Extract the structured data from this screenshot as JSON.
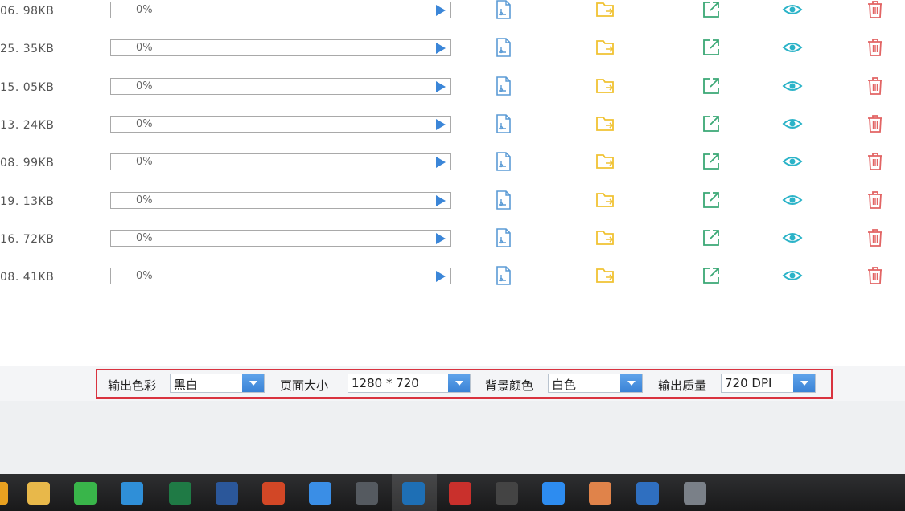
{
  "files": [
    {
      "size": "06. 98KB",
      "progress_text": "0%",
      "progress": 0
    },
    {
      "size": "25. 35KB",
      "progress_text": "0%",
      "progress": 0
    },
    {
      "size": "15. 05KB",
      "progress_text": "0%",
      "progress": 0
    },
    {
      "size": "13. 24KB",
      "progress_text": "0%",
      "progress": 0
    },
    {
      "size": "08. 99KB",
      "progress_text": "0%",
      "progress": 0
    },
    {
      "size": "19. 13KB",
      "progress_text": "0%",
      "progress": 0
    },
    {
      "size": "16. 72KB",
      "progress_text": "0%",
      "progress": 0
    },
    {
      "size": "08. 41KB",
      "progress_text": "0%",
      "progress": 0
    }
  ],
  "row_actions": [
    "file-icon",
    "folder-open-icon",
    "external-link-icon",
    "eye-icon",
    "trash-icon"
  ],
  "colors": {
    "file": "#5b9bd5",
    "folder": "#f0c233",
    "open": "#3aa875",
    "eye": "#2bb3c8",
    "trash": "#e26464",
    "play": "#3b86d8",
    "highlight": "#d9333f"
  },
  "options": {
    "color_label": "输出色彩",
    "color_value": "黑白",
    "page_size_label": "页面大小",
    "page_size_value": "1280 * 720",
    "background_label": "背景颜色",
    "background_value": "白色",
    "quality_label": "输出质量",
    "quality_value": "720 DPI"
  },
  "taskbar_icons": [
    "folder-icon",
    "wechat-icon",
    "browser-icon",
    "excel-icon",
    "word-icon",
    "powerpoint-icon",
    "edge-icon",
    "calculator-icon",
    "cad-icon",
    "app-icon",
    "pen-icon",
    "qq-browser-icon",
    "image-icon",
    "cad-viewer-icon",
    "monitor-icon"
  ]
}
